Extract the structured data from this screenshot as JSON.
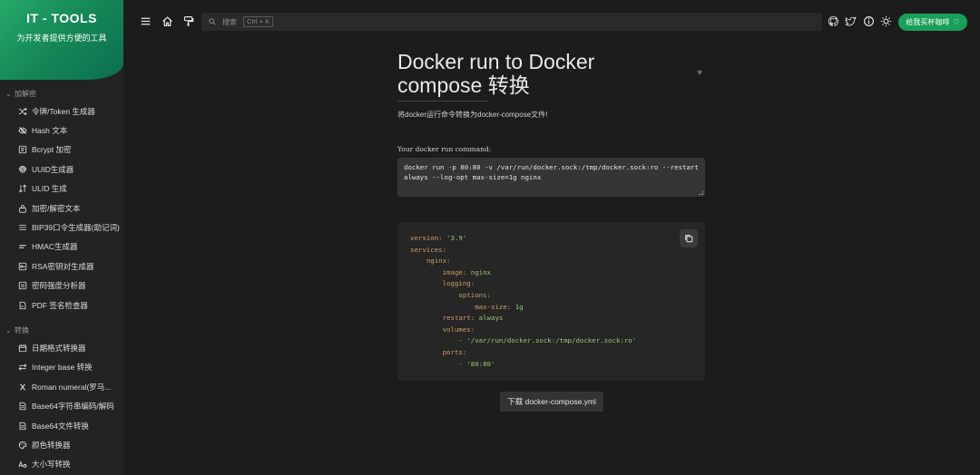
{
  "app": {
    "title": "IT - TOOLS",
    "subtitle": "为开发者提供方便的工具"
  },
  "sidebar": {
    "sections": [
      {
        "label": "加解密",
        "items": [
          {
            "icon": "shuffle-icon",
            "label": "令牌/Token 生成器"
          },
          {
            "icon": "eye-off-icon",
            "label": "Hash 文本"
          },
          {
            "icon": "hash-box-icon",
            "label": "Bcrypt 加密"
          },
          {
            "icon": "fingerprint-icon",
            "label": "UUID生成器"
          },
          {
            "icon": "sort-arrows-icon",
            "label": "ULID 生成"
          },
          {
            "icon": "lock-icon",
            "label": "加密/解密文本"
          },
          {
            "icon": "list-icon",
            "label": "BIP39口令生成器(助记词)"
          },
          {
            "icon": "short-text-icon",
            "label": "HMAC生成器"
          },
          {
            "icon": "key-box-icon",
            "label": "RSA密钥对生成器"
          },
          {
            "icon": "password-icon",
            "label": "密码强度分析器"
          },
          {
            "icon": "file-signature-icon",
            "label": "PDF 签名检查器"
          }
        ]
      },
      {
        "label": "转换",
        "items": [
          {
            "icon": "calendar-icon",
            "label": "日期格式转换器"
          },
          {
            "icon": "swap-icon",
            "label": "Integer base 转换"
          },
          {
            "icon": "letter-x-icon",
            "label": "Roman numeral(罗马..."
          },
          {
            "icon": "file-text-icon",
            "label": "Base64字符串编码/解码"
          },
          {
            "icon": "file-text-icon",
            "label": "Base64文件转换"
          },
          {
            "icon": "palette-icon",
            "label": "颜色转换器"
          },
          {
            "icon": "letter-case-icon",
            "label": "大小写转换"
          }
        ]
      }
    ]
  },
  "topbar": {
    "search_placeholder": "搜索",
    "search_shortcut": "Ctrl + K",
    "coffee_label": "给我买杯咖啡"
  },
  "main": {
    "title": "Docker run to Docker compose 转换",
    "description": "将docker运行命令转换为docker-compose文件!",
    "input_label": "Your docker run command:",
    "input_value": "docker run -p 80:80 -v /var/run/docker.sock:/tmp/docker.sock:ro --restart always --log-opt max-size=1g nginx",
    "download_label": "下载 docker-compose.yml"
  },
  "output_lines": [
    {
      "indent": "",
      "key": "version: ",
      "value": "'3.9'"
    },
    {
      "indent": "",
      "key": "services:",
      "value": ""
    },
    {
      "indent": "    ",
      "key": "nginx:",
      "value": ""
    },
    {
      "indent": "        ",
      "key": "image: ",
      "value": "nginx"
    },
    {
      "indent": "        ",
      "key": "logging:",
      "value": ""
    },
    {
      "indent": "            ",
      "key": "options:",
      "value": ""
    },
    {
      "indent": "                ",
      "key": "max-size: ",
      "value": "1g"
    },
    {
      "indent": "        ",
      "key": "restart: ",
      "value": "always"
    },
    {
      "indent": "        ",
      "key": "volumes:",
      "value": ""
    },
    {
      "indent": "            ",
      "key": "- ",
      "value": "'/var/run/docker.sock:/tmp/docker.sock:ro'"
    },
    {
      "indent": "        ",
      "key": "ports:",
      "value": ""
    },
    {
      "indent": "            ",
      "key": "- ",
      "value": "'80:80'"
    }
  ],
  "colors": {
    "accent": "#18a058",
    "yaml_key": "#d19a66",
    "yaml_value": "#98c379"
  }
}
